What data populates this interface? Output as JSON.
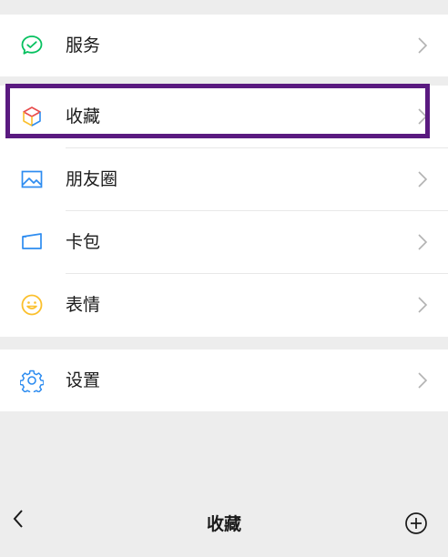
{
  "menu": {
    "items": [
      {
        "id": "services",
        "label": "服务",
        "icon": "wechat-pay-icon"
      },
      {
        "id": "favorites",
        "label": "收藏",
        "icon": "cube-icon"
      },
      {
        "id": "moments",
        "label": "朋友圈",
        "icon": "image-icon"
      },
      {
        "id": "cards",
        "label": "卡包",
        "icon": "card-icon"
      },
      {
        "id": "stickers",
        "label": "表情",
        "icon": "smiley-icon"
      },
      {
        "id": "settings",
        "label": "设置",
        "icon": "gear-icon"
      }
    ]
  },
  "bottom_bar": {
    "title": "收藏",
    "back_icon": "chevron-left-icon",
    "add_icon": "plus-circle-icon"
  },
  "colors": {
    "background": "#ededed",
    "highlight_border": "#5a1a80",
    "wechat_green": "#07c160",
    "blue": "#2d8cf0",
    "yellow": "#fbc02d"
  }
}
